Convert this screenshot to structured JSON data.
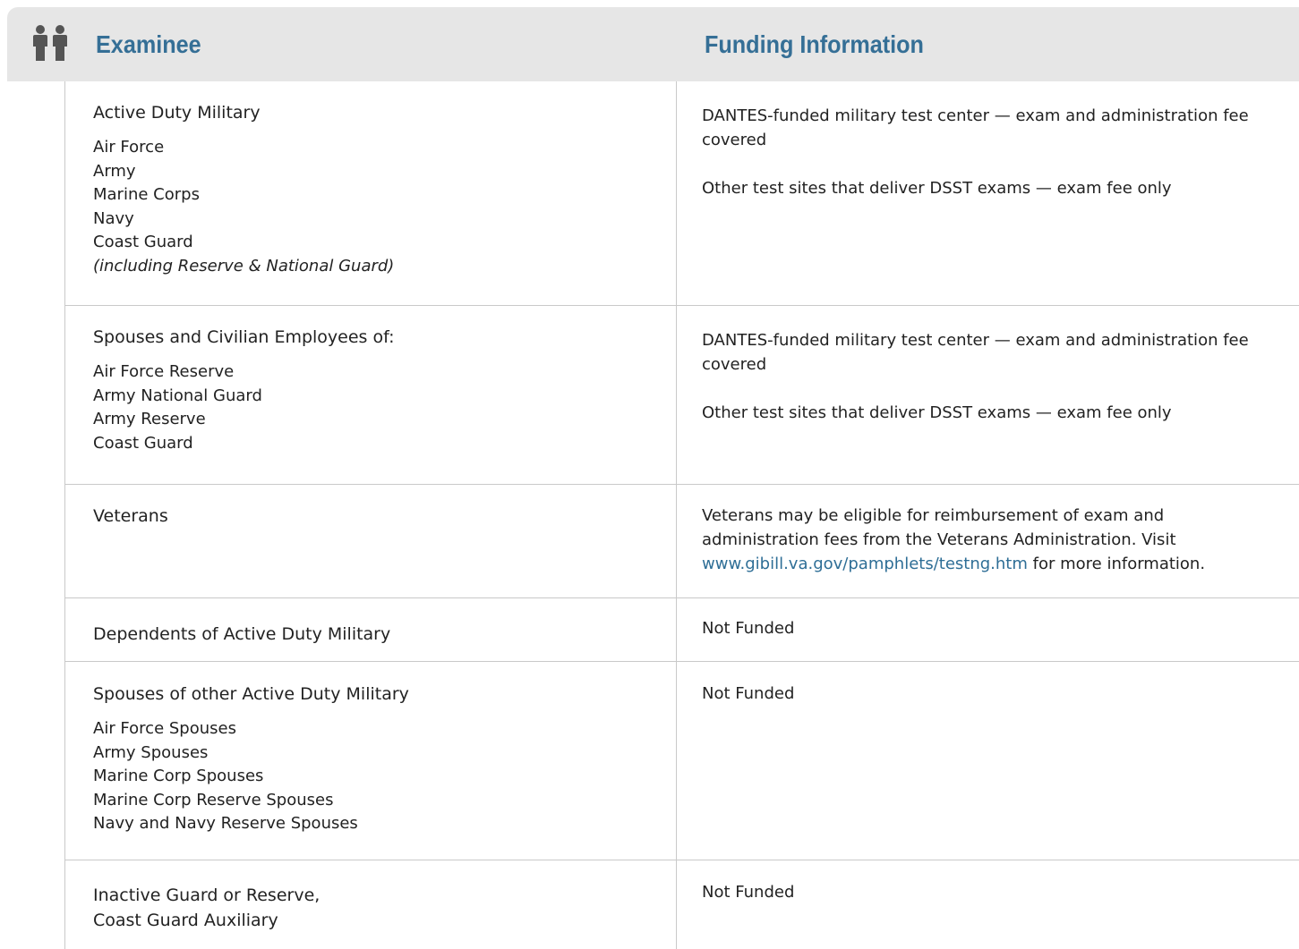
{
  "header": {
    "icon": "people-icon",
    "examinee_label": "Examinee",
    "funding_label": "Funding Information",
    "accent_color": "#356f96"
  },
  "rows": [
    {
      "title": "Active Duty Military",
      "items": [
        "Air Force",
        "Army",
        "Marine Corps",
        "Navy",
        "Coast Guard"
      ],
      "note": "(including Reserve & National Guard)",
      "funding": [
        "DANTES-funded military test center — exam and administration fee covered",
        "Other test sites that deliver DSST exams — exam fee only"
      ]
    },
    {
      "title": "Spouses and Civilian Employees of:",
      "items": [
        "Air Force Reserve",
        "Army National Guard",
        "Army Reserve",
        "Coast Guard"
      ],
      "funding": [
        "DANTES-funded military test center — exam and administration fee covered",
        "Other test sites that deliver DSST exams — exam fee only"
      ]
    },
    {
      "title": "Veterans",
      "funding_before_link": "Veterans may be eligible for reimbursement of exam and administration fees from the Veterans Administration. Visit ",
      "funding_link": "www.gibill.va.gov/pamphlets/testng.htm",
      "funding_after_link": " for more information."
    },
    {
      "title": "Dependents of Active Duty Military",
      "funding": [
        "Not Funded"
      ]
    },
    {
      "title": "Spouses of other Active Duty Military",
      "items": [
        "Air Force Spouses",
        "Army Spouses",
        "Marine Corp Spouses",
        "Marine Corp Reserve Spouses",
        "Navy and Navy Reserve Spouses"
      ],
      "funding": [
        "Not Funded"
      ]
    },
    {
      "title_lines": [
        "Inactive Guard or Reserve,",
        "Coast Guard Auxiliary"
      ],
      "funding": [
        "Not Funded"
      ]
    }
  ]
}
